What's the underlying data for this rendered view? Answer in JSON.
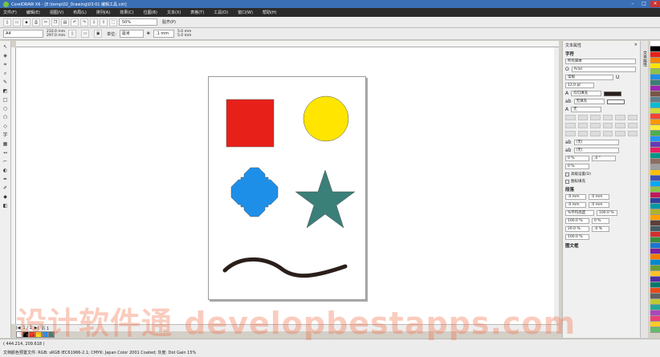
{
  "window": {
    "title": "CorelDRAW X6 - [E:\\temp\\02_Drawing\\03-01 编辑工具.cdr]"
  },
  "menu": [
    "文件(F)",
    "编辑(E)",
    "视图(V)",
    "布局(L)",
    "排列(A)",
    "效果(C)",
    "位图(B)",
    "文本(X)",
    "表格(T)",
    "工具(O)",
    "窗口(W)",
    "帮助(H)"
  ],
  "toolbar": {
    "zoom": "50%",
    "snap_label": "贴齐(P)"
  },
  "property_bar": {
    "page_size": "A4",
    "width": "210.0 mm",
    "height": "297.0 mm",
    "units_label": "单位:",
    "units": "毫米",
    "nudge": ".1 mm",
    "dup_x": "5.0 mm",
    "dup_y": "5.0 mm"
  },
  "docker": {
    "title": "文本属性",
    "char_section": "字符",
    "script": "所有脚本",
    "font": "Arial",
    "style": "常规",
    "size": "12.0 pt",
    "fill_uniform": "均匀填充",
    "bg_fill": "无填充",
    "outline": "无",
    "opt_a": "(无)",
    "opt_b": "(无)",
    "kern": "0 %",
    "char_angle": ".0 °",
    "offset_y": "0 %",
    "chk1": "高级设置(D)",
    "chk2": "图标填充",
    "para_section": "段落",
    "indent1": ".0 mm",
    "indent2": ".0 mm",
    "indent3": ".0 mm",
    "indent4": ".0 mm",
    "spacing_mode": "%字符高度",
    "line_pct": "100.0 %",
    "before_pct": "100.0 %",
    "after_pct": "0 %",
    "word_pct": "20.0 %",
    "last_val": ".0 %",
    "lang_pct": "100.0 %",
    "frame_section": "图文框",
    "side_tab": "文本属性"
  },
  "page_nav": {
    "label": "1 / 1",
    "page_tab": "页 1"
  },
  "status": {
    "coords": "( 444.214, 209.618 )",
    "profile": "文档颜色预置文件: RGB: sRGB IEC61966-2.1; CMYK: Japan Color 2001 Coated; 灰度: Dot Gain 15%"
  },
  "colors": {
    "square": "#e8201a",
    "circle": "#ffe500",
    "cross": "#1e8fe8",
    "star": "#3a7f78",
    "stroke": "#2a1f1a",
    "palette": [
      "#ffffff",
      "#000000",
      "#e8201a",
      "#ff8000",
      "#ffe500",
      "#8bc34a",
      "#1e8fe8",
      "#3a7f78",
      "#9c27b0",
      "#795548",
      "#607d8b",
      "#00bcd4",
      "#cddc39",
      "#f44336",
      "#ff9800",
      "#ffeb3b",
      "#4caf50",
      "#2196f3",
      "#673ab7",
      "#e91e63",
      "#009688",
      "#8d6e63",
      "#9e9e9e",
      "#ffc107",
      "#3f51b5",
      "#03a9f4",
      "#8bc34a",
      "#c2185b",
      "#303f9f",
      "#0097a7",
      "#afb42b",
      "#ffa000",
      "#5d4037",
      "#455a64",
      "#d32f2f",
      "#388e3c",
      "#1976d2",
      "#7b1fa2",
      "#f57c00",
      "#0288d1",
      "#689f38",
      "#fbc02d",
      "#512da8",
      "#00796b",
      "#e64a19",
      "#616161",
      "#c0ca33",
      "#26a69a",
      "#ab47bc",
      "#ec407a",
      "#ffca28",
      "#66bb6a"
    ]
  },
  "watermark": "设计软件通 developbestapps.com"
}
